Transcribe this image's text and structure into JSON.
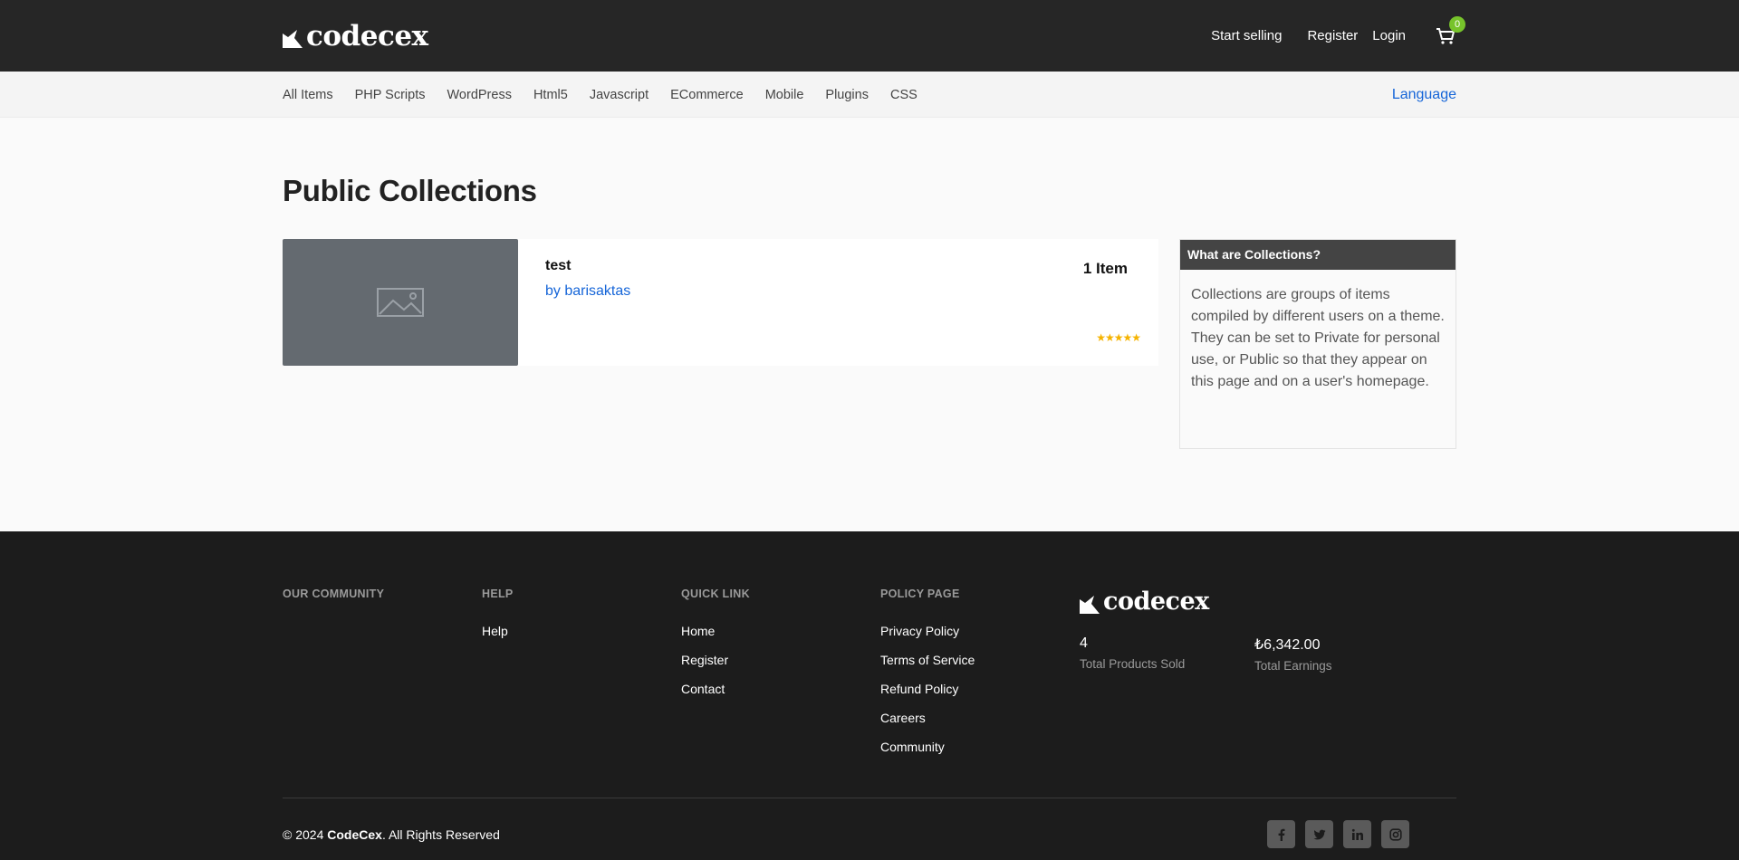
{
  "header": {
    "logo_text": "codecex",
    "start_selling": "Start selling",
    "register": "Register",
    "login": "Login",
    "cart_count": "0"
  },
  "nav": {
    "items": [
      "All Items",
      "PHP Scripts",
      "WordPress",
      "Html5",
      "Javascript",
      "ECommerce",
      "Mobile",
      "Plugins",
      "CSS"
    ],
    "language": "Language"
  },
  "main": {
    "title": "Public Collections",
    "collection": {
      "title": "test",
      "author": "by barisaktas",
      "count": "1 Item",
      "stars": "★★★★★"
    },
    "sidebar": {
      "heading": "What are Collections?",
      "text": "Collections are groups of items compiled by different users on a theme. They can be set to Private for personal use, or Public so that they appear on this page and on a user's homepage."
    }
  },
  "footer": {
    "community_heading": "OUR COMMUNITY",
    "help_heading": "HELP",
    "help_links": [
      "Help"
    ],
    "quick_heading": "QUICK LINK",
    "quick_links": [
      "Home",
      "Register",
      "Contact"
    ],
    "policy_heading": "POLICY PAGE",
    "policy_links": [
      "Privacy Policy",
      "Terms of Service",
      "Refund Policy",
      "Careers",
      "Community"
    ],
    "logo_text": "codecex",
    "stat_products_value": "4",
    "stat_products_label": "Total Products Sold",
    "stat_earnings_value": "₺6,342.00",
    "stat_earnings_label": "Total Earnings",
    "copyright_prefix": "© 2024 ",
    "copyright_brand": "CodeCex",
    "copyright_suffix": ". All Rights Reserved",
    "socials": [
      "facebook",
      "twitter",
      "linkedin",
      "instagram"
    ]
  }
}
